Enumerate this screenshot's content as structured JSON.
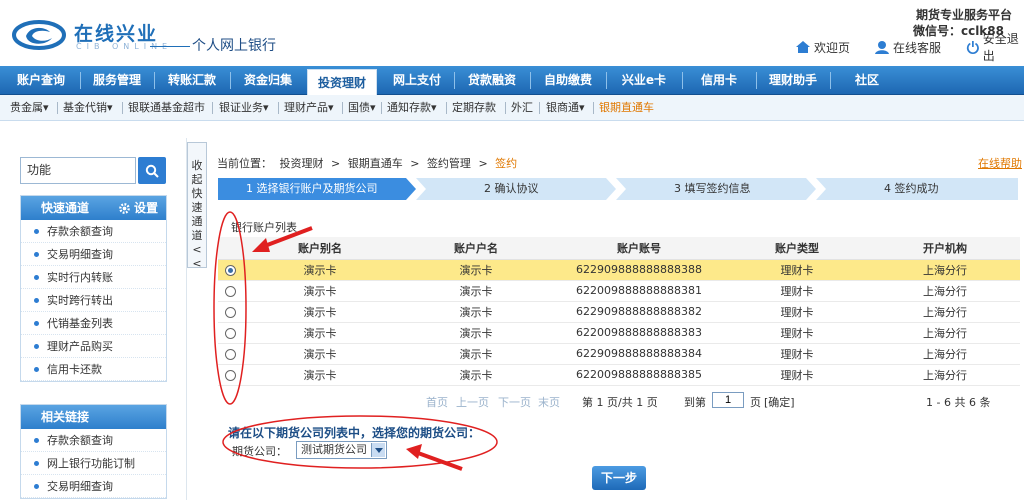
{
  "header": {
    "logo_cn": "在线兴业",
    "logo_en": "CIB ONLINE",
    "bank_title": "个人网上银行",
    "promo_line1": "期货专业服务平台",
    "promo_line2": "微信号：cclk88",
    "home_label": "欢迎页",
    "service_label": "在线客服",
    "logout_label": "安全退出"
  },
  "main_nav": [
    {
      "label": "账户查询"
    },
    {
      "label": "服务管理"
    },
    {
      "label": "转账汇款"
    },
    {
      "label": "资金归集"
    },
    {
      "label": "投资理财"
    },
    {
      "label": "网上支付"
    },
    {
      "label": "贷款融资"
    },
    {
      "label": "自助缴费"
    },
    {
      "label": "兴业e卡"
    },
    {
      "label": "信用卡"
    },
    {
      "label": "理财助手"
    },
    {
      "label": "社区"
    }
  ],
  "sub_nav": [
    {
      "label": "贵金属▾"
    },
    {
      "label": "基金代销▾"
    },
    {
      "label": "银联通基金超市"
    },
    {
      "label": "银证业务▾"
    },
    {
      "label": "理财产品▾"
    },
    {
      "label": "国债▾"
    },
    {
      "label": "通知存款▾"
    },
    {
      "label": "定期存款"
    },
    {
      "label": "外汇"
    },
    {
      "label": "银商通▾"
    },
    {
      "label": "银期直通车"
    }
  ],
  "sidebar": {
    "search_value": "功能",
    "quick_title": "快速通道",
    "settings_label": "设置",
    "quick_items": [
      {
        "label": "存款余额查询"
      },
      {
        "label": "交易明细查询"
      },
      {
        "label": "实时行内转账"
      },
      {
        "label": "实时跨行转出"
      },
      {
        "label": "代销基金列表"
      },
      {
        "label": "理财产品购买"
      },
      {
        "label": "信用卡还款"
      }
    ],
    "related_title": "相关链接",
    "related_items": [
      {
        "label": "存款余额查询"
      },
      {
        "label": "网上银行功能订制"
      },
      {
        "label": "交易明细查询"
      }
    ]
  },
  "collapse_tab": "收起快速通道<<",
  "breadcrumb": {
    "prefix": "当前位置：",
    "items": [
      "投资理财",
      ">",
      "银期直通车",
      ">",
      "签约管理",
      ">",
      "签约"
    ]
  },
  "help_link": "在线帮助",
  "steps": [
    {
      "label": "1  选择银行账户及期货公司"
    },
    {
      "label": "2  确认协议"
    },
    {
      "label": "3  填写签约信息"
    },
    {
      "label": "4  签约成功"
    }
  ],
  "account_list_title": "银行账户列表",
  "table": {
    "headers": [
      "",
      "账户别名",
      "账户户名",
      "账户账号",
      "账户类型",
      "开户机构"
    ],
    "rows": [
      {
        "alias": "演示卡",
        "name": "演示卡",
        "number": "622909888888888388",
        "type": "理财卡",
        "branch": "上海分行",
        "selected": true
      },
      {
        "alias": "演示卡",
        "name": "演示卡",
        "number": "622009888888888381",
        "type": "理财卡",
        "branch": "上海分行",
        "selected": false
      },
      {
        "alias": "演示卡",
        "name": "演示卡",
        "number": "622909888888888382",
        "type": "理财卡",
        "branch": "上海分行",
        "selected": false
      },
      {
        "alias": "演示卡",
        "name": "演示卡",
        "number": "622009888888888383",
        "type": "理财卡",
        "branch": "上海分行",
        "selected": false
      },
      {
        "alias": "演示卡",
        "name": "演示卡",
        "number": "622909888888888384",
        "type": "理财卡",
        "branch": "上海分行",
        "selected": false
      },
      {
        "alias": "演示卡",
        "name": "演示卡",
        "number": "622009888888888385",
        "type": "理财卡",
        "branch": "上海分行",
        "selected": false
      }
    ]
  },
  "pager": {
    "first": "首页",
    "prev": "上一页",
    "next": "下一页",
    "last": "末页",
    "page_info": "第 1 页/共 1 页",
    "goto_prefix": "到第",
    "goto_value": "1",
    "goto_suffix": "页",
    "confirm": "[确定]",
    "range_info": "1 - 6  共 6 条"
  },
  "futures": {
    "prompt": "请在以下期货公司列表中，选择您的期货公司：",
    "company_label": "期货公司：",
    "company_value": "测试期货公司"
  },
  "next_button": "下一步",
  "colors": {
    "nav_blue": "#1d67b2",
    "accent_orange": "#e07800",
    "selected_row": "#fde98a",
    "annotation_red": "#e02020"
  }
}
